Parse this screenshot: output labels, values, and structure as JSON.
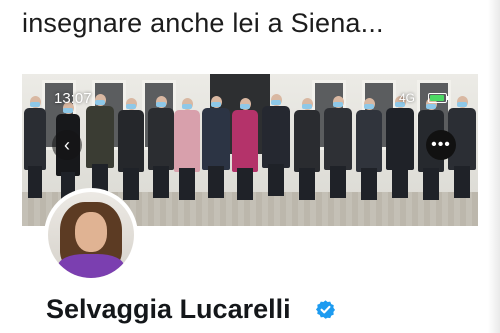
{
  "caption": {
    "text": "insegnare anche lei a Siena..."
  },
  "phone": {
    "status_time": "13:07",
    "network": "4G",
    "battery_color": "#4cd964",
    "battery_level": 0.9
  },
  "banner": {
    "prev_icon": "chevron-left-icon",
    "more_icon": "more-horizontal-icon"
  },
  "profile": {
    "name": "Selvaggia Lucarelli",
    "verified_icon": "verified-badge-icon",
    "verified_color": "#1d9bf0"
  }
}
